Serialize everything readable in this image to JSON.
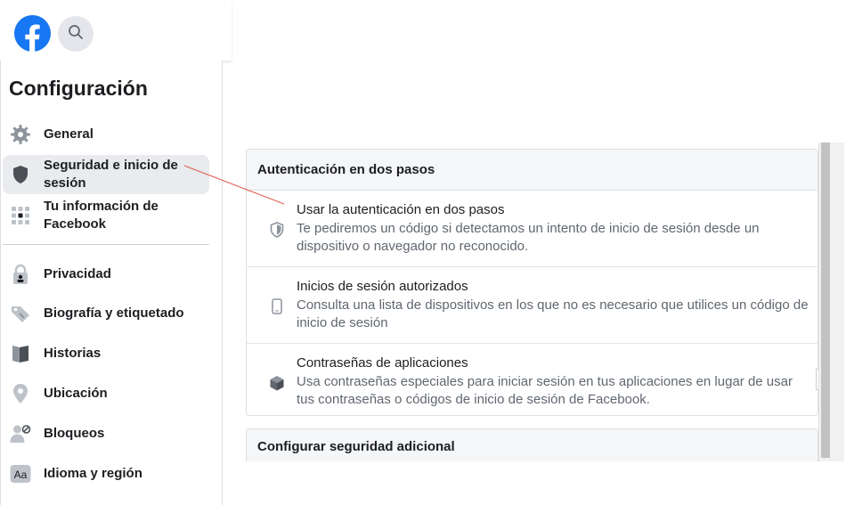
{
  "sidebar": {
    "title": "Configuración",
    "items": [
      {
        "label": "General",
        "icon": "gear-icon"
      },
      {
        "label": "Seguridad e inicio de sesión",
        "icon": "shield-icon",
        "active": true
      },
      {
        "label": "Tu información de Facebook",
        "icon": "grid-icon"
      },
      {
        "label": "Privacidad",
        "icon": "lock-icon"
      },
      {
        "label": "Biografía y etiquetado",
        "icon": "tag-icon"
      },
      {
        "label": "Historias",
        "icon": "book-icon"
      },
      {
        "label": "Ubicación",
        "icon": "location-pin-icon"
      },
      {
        "label": "Bloqueos",
        "icon": "block-user-icon"
      },
      {
        "label": "Idioma y región",
        "icon": "language-icon"
      }
    ]
  },
  "two_factor": {
    "header": "Autenticación en dos pasos",
    "rows": [
      {
        "title": "Usar la autenticación en dos pasos",
        "desc": "Te pediremos un código si detectamos un intento de inicio de sesión desde un dispositivo o navegador no reconocido.",
        "icon": "shield-icon"
      },
      {
        "title": "Inicios de sesión autorizados",
        "desc": "Consulta una lista de dispositivos en los que no es necesario que utilices un código de inicio de sesión",
        "icon": "phone-icon"
      },
      {
        "title": "Contraseñas de aplicaciones",
        "desc": "Usa contraseñas especiales para iniciar sesión en tus aplicaciones en lugar de usar tus contraseñas o códigos de inicio de sesión de Facebook.",
        "icon": "cube-icon"
      }
    ]
  },
  "extra_security": {
    "header": "Configurar seguridad adicional"
  },
  "colors": {
    "brand": "#1877f2",
    "annotation_line": "#e05a4f"
  }
}
